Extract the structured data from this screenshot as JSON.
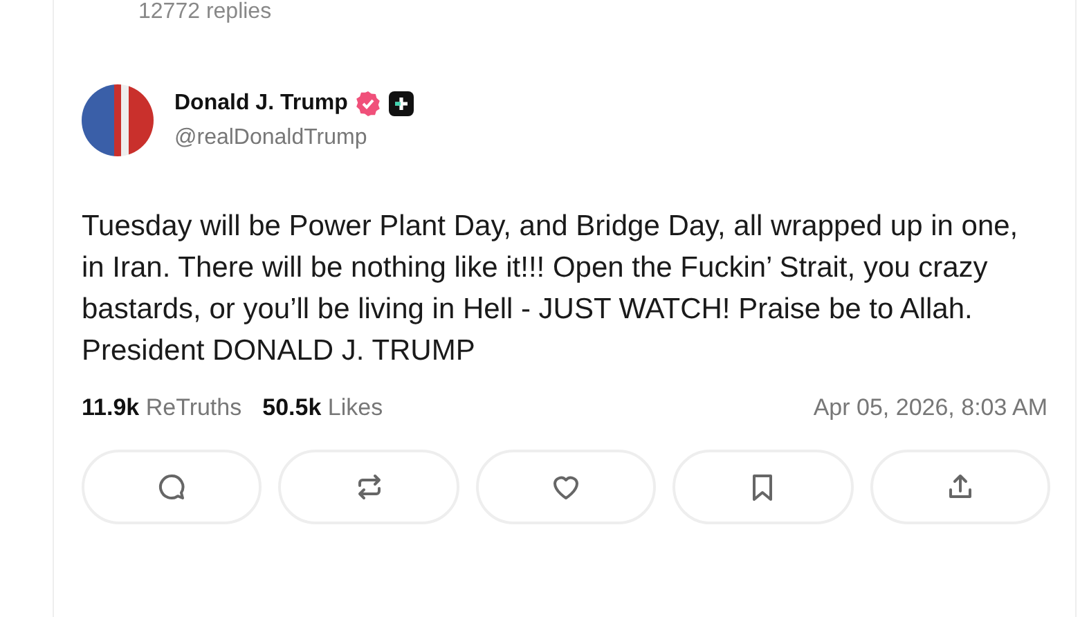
{
  "reply_count": "12772 replies",
  "author": {
    "name": "Donald J. Trump",
    "handle": "@realDonaldTrump",
    "verified": true,
    "plus_badge": true
  },
  "body": "Tuesday will be Power Plant Day, and Bridge Day, all wrapped up in one, in Iran. There will be nothing like it!!! Open the Fuckin’ Strait, you crazy bastards, or you’ll be living in Hell - JUST WATCH! Praise be to Allah. President DONALD J. TRUMP",
  "stats": [
    {
      "count": "11.9k",
      "label": "ReTruths"
    },
    {
      "count": "50.5k",
      "label": "Likes"
    }
  ],
  "timestamp": "Apr 05, 2026, 8:03 AM",
  "actions": [
    {
      "kind": "reply"
    },
    {
      "kind": "retruth"
    },
    {
      "kind": "like"
    },
    {
      "kind": "bookmark"
    },
    {
      "kind": "share"
    }
  ]
}
